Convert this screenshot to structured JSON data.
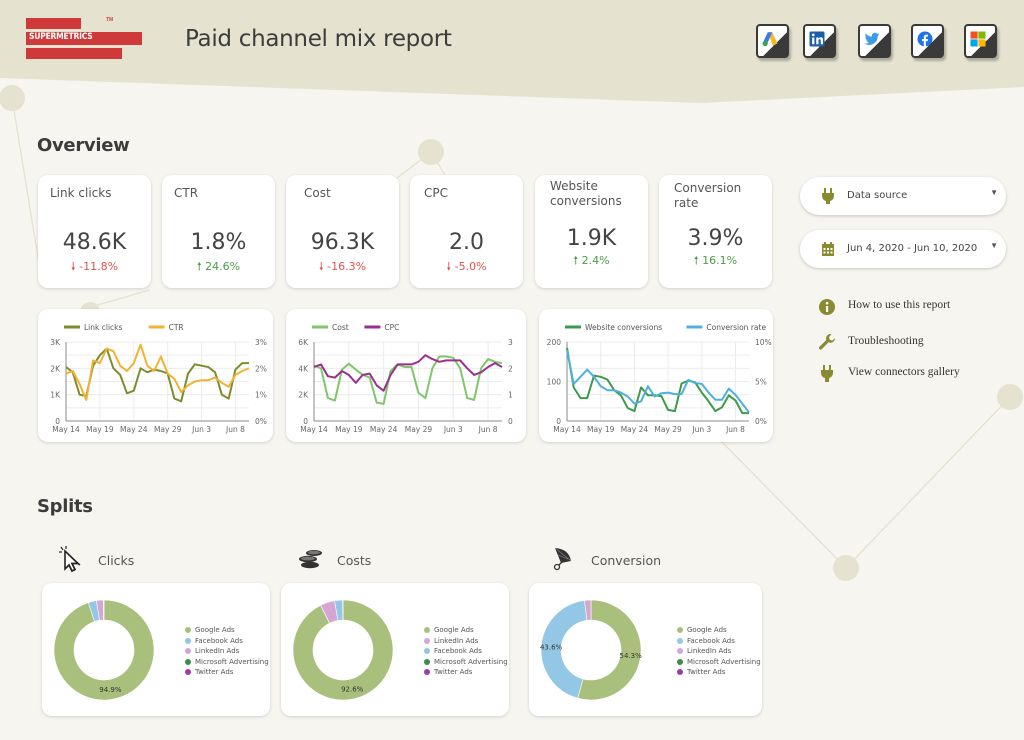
{
  "header": {
    "logo_text": "SUPERMETRICS",
    "logo_tm": "TM",
    "title": "Paid channel mix report",
    "connectors": [
      {
        "name": "google-ads",
        "icon": "google-ads-icon"
      },
      {
        "name": "linkedin",
        "icon": "linkedin-icon"
      },
      {
        "name": "twitter",
        "icon": "twitter-icon"
      },
      {
        "name": "facebook",
        "icon": "facebook-icon"
      },
      {
        "name": "microsoft",
        "icon": "microsoft-icon"
      }
    ]
  },
  "overview": {
    "title": "Overview",
    "kpis": [
      {
        "label": "Link clicks",
        "value": "48.6K",
        "delta": "-11.8%",
        "direction": "down"
      },
      {
        "label": "CTR",
        "value": "1.8%",
        "delta": "24.6%",
        "direction": "up"
      },
      {
        "label": "Cost",
        "value": "96.3K",
        "delta": "-16.3%",
        "direction": "down"
      },
      {
        "label": "CPC",
        "value": "2.0",
        "delta": "-5.0%",
        "direction": "down"
      },
      {
        "label": "Website conversions",
        "value": "1.9K",
        "delta": "2.4%",
        "direction": "up"
      },
      {
        "label": "Conversion rate",
        "value": "3.9%",
        "delta": "16.1%",
        "direction": "up"
      }
    ]
  },
  "controls": {
    "data_source": {
      "label": "Data source",
      "icon": "plug-icon"
    },
    "date_range": {
      "label": "Jun 4, 2020 - Jun 10, 2020",
      "icon": "calendar-icon"
    }
  },
  "links": [
    {
      "label": "How to use this report",
      "icon": "info-icon"
    },
    {
      "label": "Troubleshooting",
      "icon": "wrench-icon"
    },
    {
      "label": "View connectors gallery",
      "icon": "plug-icon"
    }
  ],
  "splits": {
    "title": "Splits",
    "sections": [
      {
        "label": "Clicks",
        "icon": "cursor-click-icon"
      },
      {
        "label": "Costs",
        "icon": "coins-icon"
      },
      {
        "label": "Conversion",
        "icon": "megaphone-icon"
      }
    ]
  },
  "colors": {
    "link_clicks": "#7f8c2d",
    "ctr": "#f2b234",
    "cost": "#7fc66b",
    "cpc": "#9b2f8f",
    "website_conversions": "#3d9a4c",
    "conversion_rate": "#4fb0dc",
    "google_ads": "#a9c07c",
    "facebook_ads": "#93c7e6",
    "linkedin_ads": "#d5a6d3",
    "microsoft_advertising": "#3a8d4e",
    "twitter_ads": "#9c3ab0",
    "up": "#4a9c44",
    "down": "#e0524c",
    "brand": "#d0393a",
    "olive": "#8a8a32"
  },
  "chart_data": [
    {
      "type": "line",
      "title": "Link clicks & CTR",
      "x": [
        "May 14",
        "May 15",
        "May 16",
        "May 17",
        "May 18",
        "May 19",
        "May 20",
        "May 21",
        "May 22",
        "May 23",
        "May 24",
        "May 25",
        "May 26",
        "May 27",
        "May 28",
        "May 29",
        "May 30",
        "May 31",
        "Jun 1",
        "Jun 2",
        "Jun 3",
        "Jun 4",
        "Jun 5",
        "Jun 6",
        "Jun 7",
        "Jun 8",
        "Jun 9",
        "Jun 10"
      ],
      "xticks": [
        "May 14",
        "May 19",
        "May 24",
        "May 29",
        "Jun 3",
        "Jun 8"
      ],
      "series": [
        {
          "name": "Link clicks",
          "axis": "left",
          "color_key": "link_clicks",
          "values": [
            2050,
            1850,
            1000,
            950,
            2100,
            2500,
            2750,
            2000,
            1750,
            1050,
            1150,
            2000,
            1850,
            1950,
            1900,
            1800,
            850,
            750,
            1800,
            2150,
            2100,
            2050,
            1850,
            1000,
            850,
            1950,
            2200,
            2200
          ]
        },
        {
          "name": "CTR",
          "axis": "right",
          "color_key": "ctr",
          "values": [
            1.8,
            1.9,
            1.4,
            0.8,
            2.3,
            2.2,
            2.75,
            2.65,
            2.1,
            1.9,
            2.2,
            2.9,
            2.1,
            1.9,
            2.45,
            1.8,
            1.6,
            1.1,
            1.35,
            1.5,
            1.55,
            1.55,
            1.65,
            1.45,
            1.3,
            1.75,
            1.9,
            2.0
          ]
        }
      ],
      "y_left": {
        "ticks": [
          "0",
          "1K",
          "2K",
          "3K"
        ],
        "range": [
          0,
          3000
        ]
      },
      "y_right": {
        "ticks": [
          "0%",
          "1%",
          "2%",
          "3%"
        ],
        "range": [
          0,
          3
        ]
      }
    },
    {
      "type": "line",
      "title": "Cost & CPC",
      "x": [
        "May 14",
        "May 15",
        "May 16",
        "May 17",
        "May 18",
        "May 19",
        "May 20",
        "May 21",
        "May 22",
        "May 23",
        "May 24",
        "May 25",
        "May 26",
        "May 27",
        "May 28",
        "May 29",
        "May 30",
        "May 31",
        "Jun 1",
        "Jun 2",
        "Jun 3",
        "Jun 4",
        "Jun 5",
        "Jun 6",
        "Jun 7",
        "Jun 8",
        "Jun 9",
        "Jun 10"
      ],
      "xticks": [
        "May 14",
        "May 19",
        "May 24",
        "May 29",
        "Jun 3",
        "Jun 8"
      ],
      "series": [
        {
          "name": "Cost",
          "axis": "left",
          "color_key": "cost",
          "values": [
            4200,
            4000,
            1750,
            1550,
            3900,
            4350,
            3900,
            3500,
            3300,
            1400,
            1300,
            3800,
            4300,
            4100,
            4100,
            2150,
            1750,
            4000,
            4900,
            4900,
            4800,
            4000,
            1750,
            1600,
            4000,
            4700,
            4500,
            4400
          ]
        },
        {
          "name": "CPC",
          "axis": "right",
          "color_key": "cpc",
          "values": [
            2.05,
            2.15,
            1.7,
            1.65,
            1.9,
            1.75,
            1.45,
            1.75,
            1.8,
            1.35,
            1.15,
            1.75,
            2.15,
            2.15,
            2.15,
            2.25,
            2.5,
            2.35,
            2.25,
            2.3,
            2.3,
            2.3,
            2.0,
            1.75,
            1.85,
            2.05,
            2.2,
            2.05
          ]
        }
      ],
      "y_left": {
        "ticks": [
          "0",
          "2K",
          "4K",
          "6K"
        ],
        "range": [
          0,
          6000
        ]
      },
      "y_right": {
        "ticks": [
          "0",
          "1",
          "2",
          "3"
        ],
        "range": [
          0,
          3
        ]
      }
    },
    {
      "type": "line",
      "title": "Website conversions & Conversion rate",
      "x": [
        "May 14",
        "May 15",
        "May 16",
        "May 17",
        "May 18",
        "May 19",
        "May 20",
        "May 21",
        "May 22",
        "May 23",
        "May 24",
        "May 25",
        "May 26",
        "May 27",
        "May 28",
        "May 29",
        "May 30",
        "May 31",
        "Jun 1",
        "Jun 2",
        "Jun 3",
        "Jun 4",
        "Jun 5",
        "Jun 6",
        "Jun 7",
        "Jun 8",
        "Jun 9",
        "Jun 10"
      ],
      "xticks": [
        "May 14",
        "May 19",
        "May 24",
        "May 29",
        "Jun 3",
        "Jun 8"
      ],
      "series": [
        {
          "name": "Website conversions",
          "axis": "left",
          "color_key": "website_conversions",
          "values": [
            185,
            85,
            58,
            58,
            115,
            112,
            105,
            78,
            65,
            33,
            25,
            85,
            65,
            65,
            63,
            28,
            25,
            95,
            102,
            98,
            72,
            50,
            25,
            35,
            65,
            52,
            20,
            20
          ]
        },
        {
          "name": "Conversion rate",
          "axis": "right",
          "color_key": "conversion_rate",
          "values": [
            9.0,
            4.7,
            5.6,
            6.5,
            5.6,
            4.4,
            3.9,
            3.9,
            3.6,
            3.1,
            2.2,
            2.5,
            4.4,
            3.1,
            3.5,
            3.6,
            3.4,
            3.4,
            5.2,
            4.8,
            4.7,
            3.6,
            2.7,
            2.7,
            4.1,
            3.3,
            2.2,
            1.1
          ]
        }
      ],
      "y_left": {
        "ticks": [
          "0",
          "100",
          "200"
        ],
        "range": [
          0,
          200
        ]
      },
      "y_right": {
        "ticks": [
          "0%",
          "5%",
          "10%"
        ],
        "range": [
          0,
          10
        ]
      }
    },
    {
      "type": "pie",
      "title": "Clicks",
      "donut": true,
      "slices": [
        {
          "name": "Google Ads",
          "value": 94.9,
          "color_key": "google_ads",
          "label": "94.9%"
        },
        {
          "name": "Facebook Ads",
          "value": 2.7,
          "color_key": "facebook_ads",
          "label": ""
        },
        {
          "name": "LinkedIn Ads",
          "value": 2.2,
          "color_key": "linkedin_ads",
          "label": ""
        },
        {
          "name": "Microsoft Advertising",
          "value": 0.2,
          "color_key": "microsoft_advertising",
          "label": ""
        },
        {
          "name": "Twitter Ads",
          "value": 0.0,
          "color_key": "twitter_ads",
          "label": ""
        }
      ],
      "legend": [
        "Google Ads",
        "Facebook Ads",
        "LinkedIn Ads",
        "Microsoft Advertising",
        "Twitter Ads"
      ]
    },
    {
      "type": "pie",
      "title": "Costs",
      "donut": true,
      "slices": [
        {
          "name": "Google Ads",
          "value": 92.6,
          "color_key": "google_ads",
          "label": "92.6%"
        },
        {
          "name": "LinkedIn Ads",
          "value": 4.7,
          "color_key": "linkedin_ads",
          "label": ""
        },
        {
          "name": "Facebook Ads",
          "value": 2.6,
          "color_key": "facebook_ads",
          "label": ""
        },
        {
          "name": "Microsoft Advertising",
          "value": 0.1,
          "color_key": "microsoft_advertising",
          "label": ""
        },
        {
          "name": "Twitter Ads",
          "value": 0.0,
          "color_key": "twitter_ads",
          "label": ""
        }
      ],
      "legend": [
        "Google Ads",
        "LinkedIn Ads",
        "Facebook Ads",
        "Microsoft Advertising",
        "Twitter Ads"
      ]
    },
    {
      "type": "pie",
      "title": "Conversion",
      "donut": true,
      "slices": [
        {
          "name": "Google Ads",
          "value": 54.3,
          "color_key": "google_ads",
          "label": "54.3%"
        },
        {
          "name": "Facebook Ads",
          "value": 43.6,
          "color_key": "facebook_ads",
          "label": "43.6%"
        },
        {
          "name": "LinkedIn Ads",
          "value": 2.1,
          "color_key": "linkedin_ads",
          "label": ""
        },
        {
          "name": "Microsoft Advertising",
          "value": 0.0,
          "color_key": "microsoft_advertising",
          "label": ""
        },
        {
          "name": "Twitter Ads",
          "value": 0.0,
          "color_key": "twitter_ads",
          "label": ""
        }
      ],
      "legend": [
        "Google Ads",
        "Facebook Ads",
        "LinkedIn Ads",
        "Microsoft Advertising",
        "Twitter Ads"
      ]
    }
  ]
}
